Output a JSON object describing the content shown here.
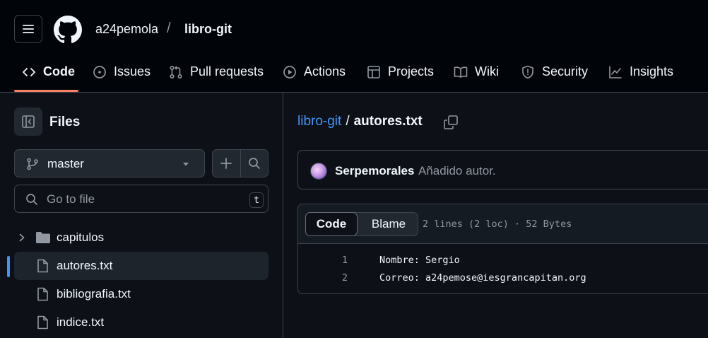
{
  "header": {
    "owner": "a24pemola",
    "separator": "/",
    "repo": "libro-git"
  },
  "tabs": [
    {
      "label": "Code",
      "icon": "code-icon",
      "active": true
    },
    {
      "label": "Issues",
      "icon": "issue-opened-icon"
    },
    {
      "label": "Pull requests",
      "icon": "git-pull-request-icon"
    },
    {
      "label": "Actions",
      "icon": "play-icon"
    },
    {
      "label": "Projects",
      "icon": "table-icon"
    },
    {
      "label": "Wiki",
      "icon": "book-icon"
    },
    {
      "label": "Security",
      "icon": "shield-icon"
    },
    {
      "label": "Insights",
      "icon": "graph-icon"
    }
  ],
  "sidebar": {
    "title": "Files",
    "branch": "master",
    "goto_placeholder": "Go to file",
    "goto_shortcut": "t",
    "tree": [
      {
        "name": "capitulos",
        "type": "folder"
      },
      {
        "name": "autores.txt",
        "type": "file",
        "selected": true
      },
      {
        "name": "bibliografia.txt",
        "type": "file"
      },
      {
        "name": "indice.txt",
        "type": "file"
      }
    ]
  },
  "main": {
    "breadcrumb_root": "libro-git",
    "breadcrumb_sep": "/",
    "breadcrumb_file": "autores.txt",
    "commit": {
      "author": "Serpemorales",
      "message": "Añadido autor."
    },
    "file": {
      "tab_code": "Code",
      "tab_blame": "Blame",
      "meta": "2 lines (2 loc) · 52 Bytes",
      "lines": [
        {
          "num": "1",
          "text": "Nombre: Sergio"
        },
        {
          "num": "2",
          "text": "Correo: a24pemose@iesgrancapitan.org"
        }
      ]
    }
  },
  "colors": {
    "accent_underline": "#f78166",
    "link": "#4493f8",
    "bg": "#0d1117",
    "header_bg": "#010409"
  }
}
